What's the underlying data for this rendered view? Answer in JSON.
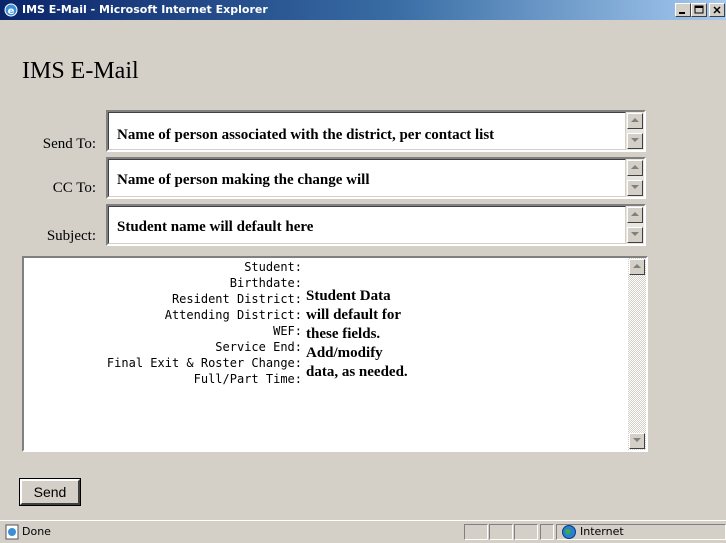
{
  "window": {
    "title": "IMS E-Mail - Microsoft Internet Explorer"
  },
  "page": {
    "heading": "IMS E-Mail"
  },
  "form": {
    "send_to": {
      "label": "Send To:",
      "value": "Name of person associated with the district, per contact list"
    },
    "cc_to": {
      "label": "CC To:",
      "value": "Name of person making the change will"
    },
    "subject": {
      "label": "Subject:",
      "value": "Student name will default here"
    },
    "body": {
      "lines": [
        "Student:",
        "Birthdate:",
        "Resident District:",
        "Attending District:",
        "WEF:",
        "Service End:",
        "Final Exit & Roster Change:",
        "Full/Part Time:"
      ],
      "note": [
        "Student Data",
        "will default for",
        "these fields.",
        "Add/modify",
        "data, as needed."
      ]
    },
    "send_label": "Send"
  },
  "status": {
    "left": "Done",
    "zone": "Internet"
  }
}
